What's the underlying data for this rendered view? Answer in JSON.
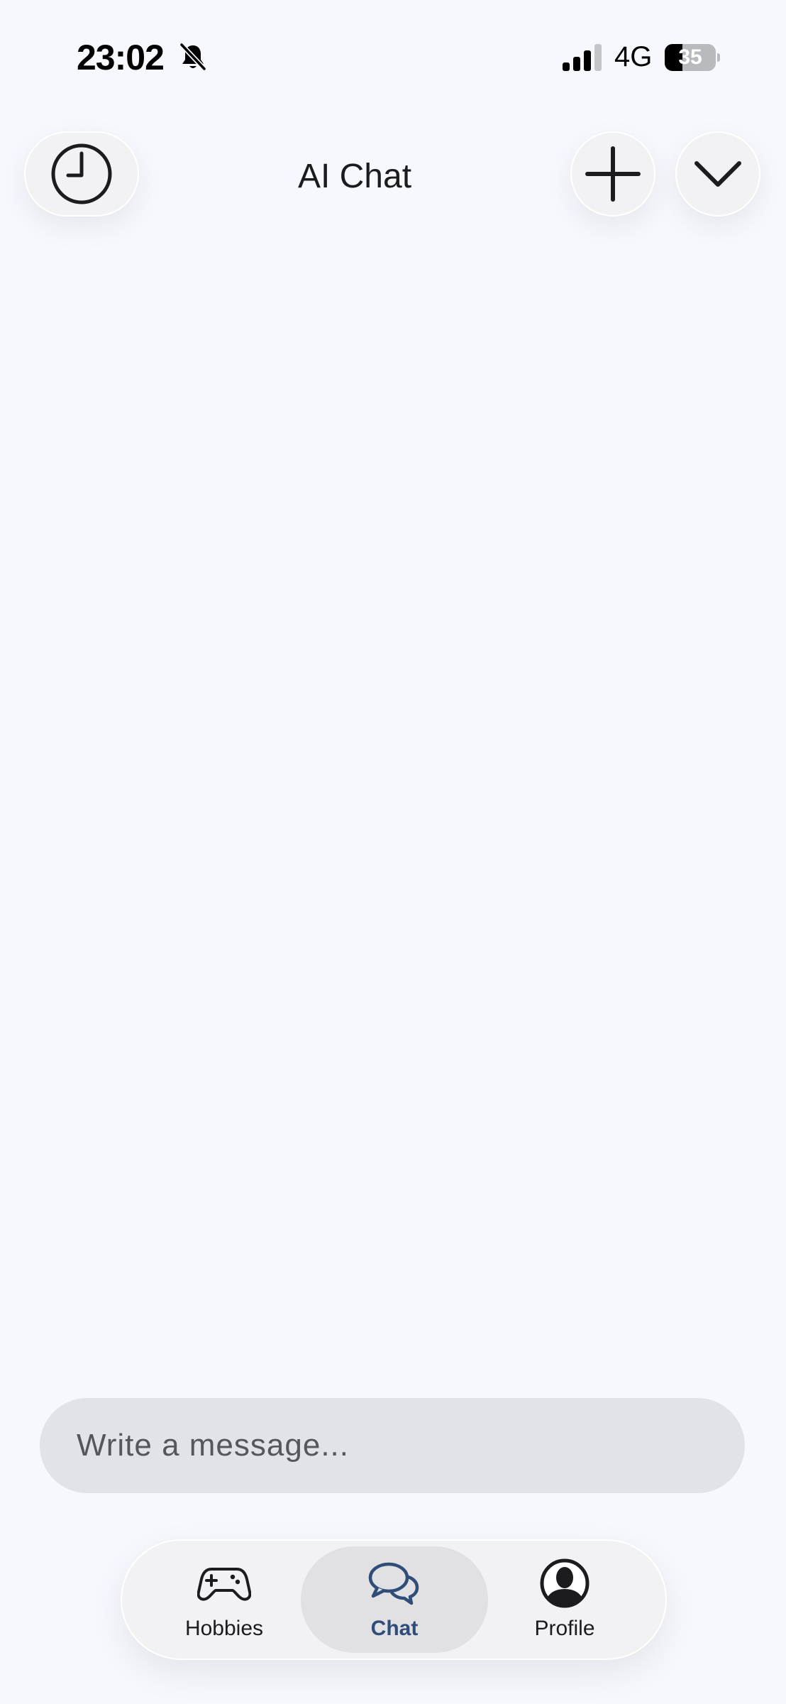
{
  "status_bar": {
    "time": "23:02",
    "network": "4G",
    "battery_level": "35",
    "battery_fraction": 0.35,
    "icons": [
      "bell-slash-icon",
      "signal-icon",
      "battery-icon"
    ]
  },
  "header": {
    "title": "AI Chat",
    "history_icon": "clock-icon",
    "new_chat_icon": "plus-icon",
    "menu_icon": "chevron-down-icon"
  },
  "composer": {
    "placeholder": "Write a message..."
  },
  "tab_bar": {
    "active": "chat",
    "active_color": "#2f4d78",
    "tabs": [
      {
        "id": "hobbies",
        "label": "Hobbies",
        "icon": "gamepad-icon"
      },
      {
        "id": "chat",
        "label": "Chat",
        "icon": "chat-bubbles-icon"
      },
      {
        "id": "profile",
        "label": "Profile",
        "icon": "user-silhouette-icon"
      }
    ]
  }
}
